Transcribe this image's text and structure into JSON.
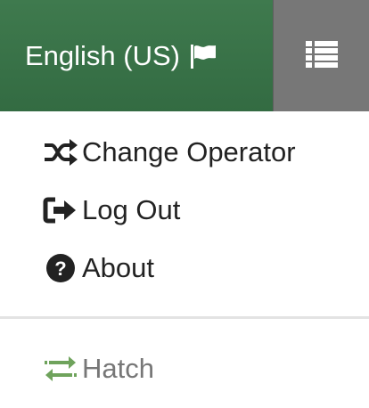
{
  "header": {
    "language_label": "English (US)",
    "language_icon": "flag-icon",
    "menu_icon": "list-icon"
  },
  "menu": {
    "items": [
      {
        "label": "Change Operator",
        "icon": "shuffle-icon"
      },
      {
        "label": "Log Out",
        "icon": "sign-out-icon"
      },
      {
        "label": "About",
        "icon": "question-circle-icon"
      }
    ],
    "secondary": {
      "label": "Hatch",
      "icon": "exchange-arrows-icon"
    }
  },
  "colors": {
    "header_green": "#3f7a4e",
    "menu_button_gray": "#777777",
    "hatch_icon_green": "#6fa35c",
    "text_dark": "#222222",
    "text_muted": "#777777"
  }
}
